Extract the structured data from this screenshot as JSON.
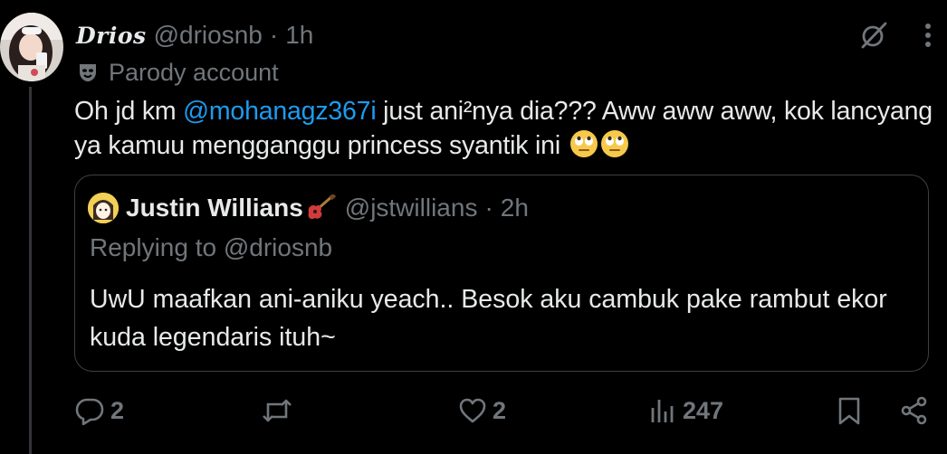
{
  "post": {
    "display_name": "Drios",
    "handle": "@driosnb",
    "separator": "·",
    "time": "1h",
    "parody_label": "Parody account",
    "text_before": "Oh jd km ",
    "mention": "@mohanagz367i",
    "text_after": " just ani²nya dia??? Aww aww aww, kok lancyang ya kamuu mengganggu princess syantik ini",
    "emojis": [
      "eye-roll-emoji",
      "eye-roll-emoji"
    ]
  },
  "quote": {
    "display_name": "Justin Willians",
    "name_emoji": "guitar-emoji",
    "handle": "@jstwillians",
    "separator": "·",
    "time": "2h",
    "replying_to": "Replying to @driosnb",
    "text": "UwU maafkan ani-aniku yeach.. Besok aku cambuk pake rambut ekor kuda legendaris ituh~"
  },
  "actions": {
    "replies": "2",
    "reposts": "",
    "likes": "2",
    "views": "247"
  },
  "icons": {
    "grok": "grok-icon",
    "more": "more-icon",
    "parody": "parody-mask-icon",
    "reply": "reply-icon",
    "repost": "repost-icon",
    "like": "like-icon",
    "views": "views-icon",
    "bookmark": "bookmark-icon",
    "share": "share-icon"
  },
  "colors": {
    "background": "#000000",
    "text": "#e7e9ea",
    "muted": "#71767b",
    "accent": "#1d9bf0",
    "border": "#3d4145"
  }
}
